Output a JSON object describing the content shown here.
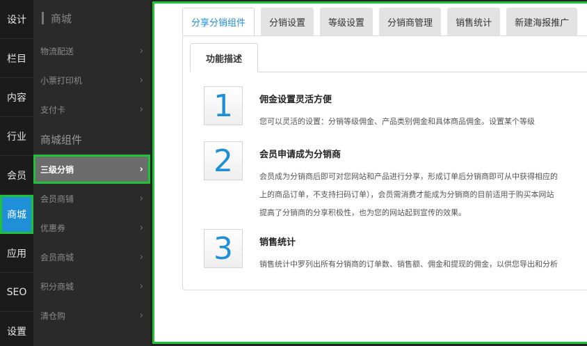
{
  "primary_nav": {
    "items": [
      {
        "label": "设计"
      },
      {
        "label": "栏目"
      },
      {
        "label": "内容"
      },
      {
        "label": "行业"
      },
      {
        "label": "会员"
      },
      {
        "label": "商城"
      },
      {
        "label": "应用"
      },
      {
        "label": "SEO"
      },
      {
        "label": "设置"
      }
    ],
    "active": "商城"
  },
  "secondary_nav": {
    "title": "商城",
    "items_top": [
      {
        "label": "物流配送"
      },
      {
        "label": "小票打印机"
      },
      {
        "label": "支付卡"
      }
    ],
    "group_label": "商城组件",
    "items_group": [
      {
        "label": "三级分销"
      },
      {
        "label": "会员商铺"
      },
      {
        "label": "优惠券"
      },
      {
        "label": "会员商城"
      },
      {
        "label": "积分商城"
      },
      {
        "label": "清仓购"
      }
    ],
    "active": "三级分销",
    "chevron": "›"
  },
  "main": {
    "tabs": [
      {
        "label": "分享分销组件"
      },
      {
        "label": "分销设置"
      },
      {
        "label": "等级设置"
      },
      {
        "label": "分销商管理"
      },
      {
        "label": "销售统计"
      },
      {
        "label": "新建海报推广"
      }
    ],
    "active_tab": "分享分销组件",
    "subtab": "功能描述",
    "features": [
      {
        "number": "1",
        "title": "佣金设置灵活方便",
        "lines": [
          "您可以灵活的设置：分销等级佣金、产品类别佣金和具体商品佣金。设置某个等级"
        ]
      },
      {
        "number": "2",
        "title": "会员申请成为分销商",
        "lines": [
          "会员成为分销商后即可对您网站和产品进行分享，形成订单后分销商即可从中获得相应的",
          "上的商品订单，不支持扫码订单），会员需消费才能成为分销商的目前适用于购买本网站",
          "提高了分销商的分享积极性，也为您的网站起到宣传的效果。"
        ]
      },
      {
        "number": "3",
        "title": "销售统计",
        "lines": [
          "销售统计中罗列出所有分销商的订单数、销售额、佣金和提现的佣金，以供您导出和分析"
        ]
      }
    ]
  },
  "colors": {
    "accent": "#1f8fd8",
    "highlight_outline": "#22c13a",
    "sidebar_bg": "#1b1b1b",
    "secondary_bg": "#2a2a2a"
  }
}
